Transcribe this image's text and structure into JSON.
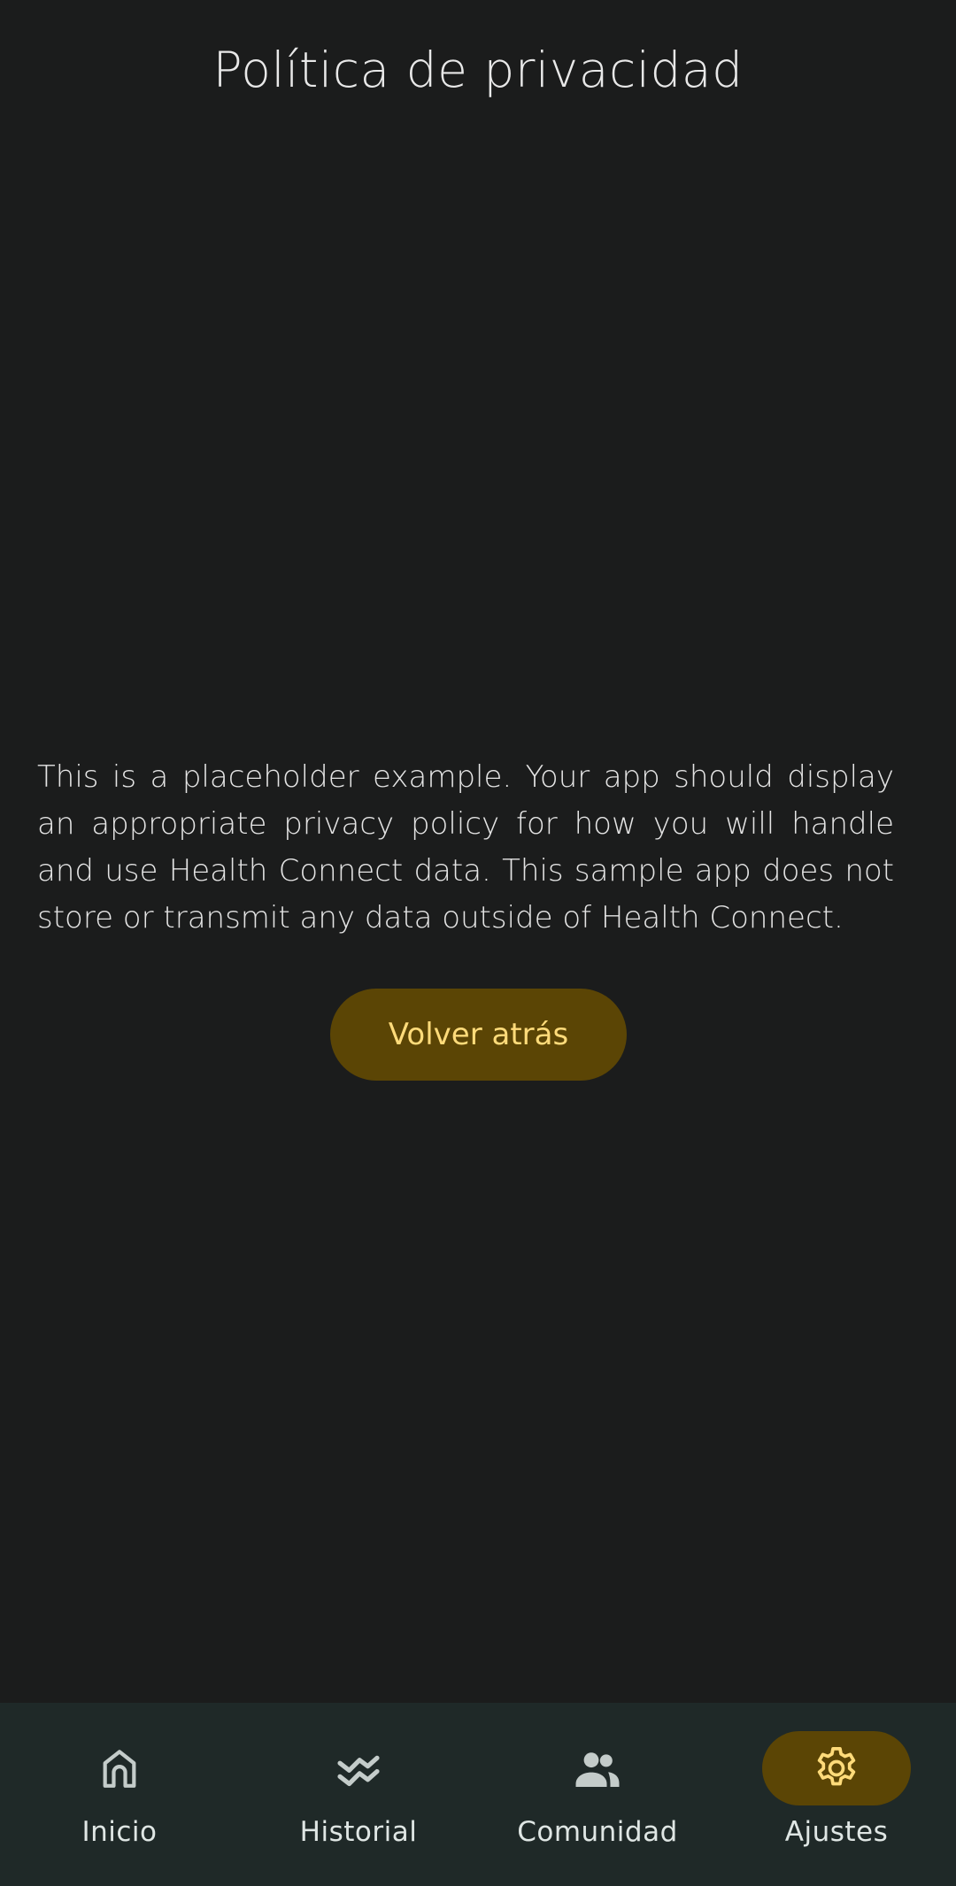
{
  "header": {
    "title": "Política de privacidad"
  },
  "main": {
    "policy_text": "This is a placeholder example. Your app should display an appropriate privacy policy for how you will handle and use Health Connect data. This sample app does not store or transmit any data outside of Health Connect.",
    "back_button_label": "Volver atrás"
  },
  "bottom_nav": {
    "items": [
      {
        "label": "Inicio",
        "icon": "home-icon",
        "active": false
      },
      {
        "label": "Historial",
        "icon": "history-icon",
        "active": false
      },
      {
        "label": "Comunidad",
        "icon": "people-icon",
        "active": false
      },
      {
        "label": "Ajustes",
        "icon": "gear-icon",
        "active": true
      }
    ]
  },
  "colors": {
    "background": "#1b1c1c",
    "nav_background": "#1f2928",
    "accent_container": "#5b4505",
    "accent_on_container": "#ffdb7a",
    "text": "#e6e6e6"
  }
}
